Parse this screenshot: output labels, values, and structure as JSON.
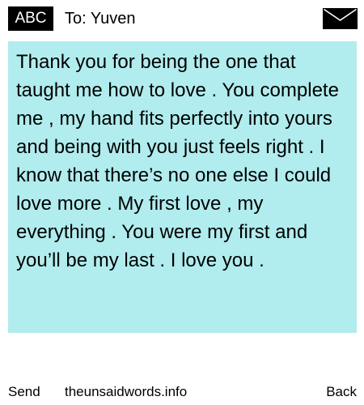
{
  "header": {
    "badge_label": "ABC",
    "to_label": "To:",
    "recipient": "Yuven",
    "icons": {
      "envelope": "envelope-icon"
    }
  },
  "message": {
    "body": "Thank you for being the one that taught me how to love . You complete me , my hand fits perfectly into yours and being with you just feels right . I know that there’s no one else I could love more . My first love , my everything . You were my first and you’ll be my last . I love you ."
  },
  "footer": {
    "send_label": "Send",
    "site_label": "theunsaidwords.info",
    "back_label": "Back"
  },
  "colors": {
    "message_background": "#b1ecee",
    "badge_background": "#000000",
    "badge_text": "#ffffff",
    "text": "#000000",
    "page_background": "#ffffff"
  }
}
